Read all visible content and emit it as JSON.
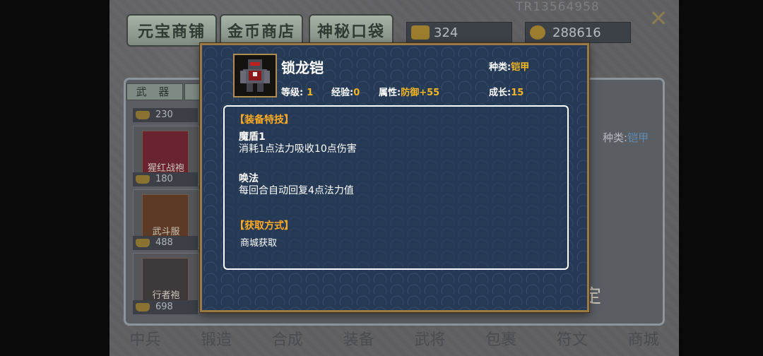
{
  "background": {
    "role_id": "TR13564958",
    "tabs": [
      "元宝商铺",
      "金币商店",
      "神秘口袋"
    ],
    "currencies": {
      "ingot": "324",
      "coin": "288616"
    },
    "side_tab": "武 器",
    "items": [
      {
        "name": "",
        "price": "230"
      },
      {
        "name": "猩红战袍",
        "price": "180"
      },
      {
        "name": "武斗服",
        "price": "488"
      },
      {
        "name": "行者袍",
        "price": "698"
      }
    ],
    "kind_label": "种类:",
    "kind_value": "铠甲",
    "confirm_char": "定",
    "bottom_nav": [
      "中兵",
      "锻造",
      "合成",
      "装备",
      "武将",
      "包裹",
      "符文",
      "商城"
    ]
  },
  "dialog": {
    "name": "锁龙铠",
    "type_label": "种类:",
    "type_value": "铠甲",
    "level_label": "等级:",
    "level_value": "1",
    "exp_label": "经验:",
    "exp_value": "0",
    "attr_label": "属性:",
    "attr_value": "防御+55",
    "growth_label": "成长:",
    "growth_value": "15",
    "skills_header": "【装备特技】",
    "skills": [
      {
        "name": "魔盾1",
        "desc": "消耗1点法力吸收10点伤害"
      },
      {
        "name": "唤法",
        "desc": "每回合自动回复4点法力值"
      }
    ],
    "acquire_header": "【获取方式】",
    "acquire_text": "商城获取"
  },
  "colors": {
    "dialog_bg": "#263a55",
    "dialog_border": "#9b7a45",
    "highlight": "#f3b623",
    "section_header": "#ffab22"
  },
  "icons": [
    "close-x-icon",
    "gold-ingot-icon",
    "gold-coin-icon",
    "armor-icon"
  ]
}
